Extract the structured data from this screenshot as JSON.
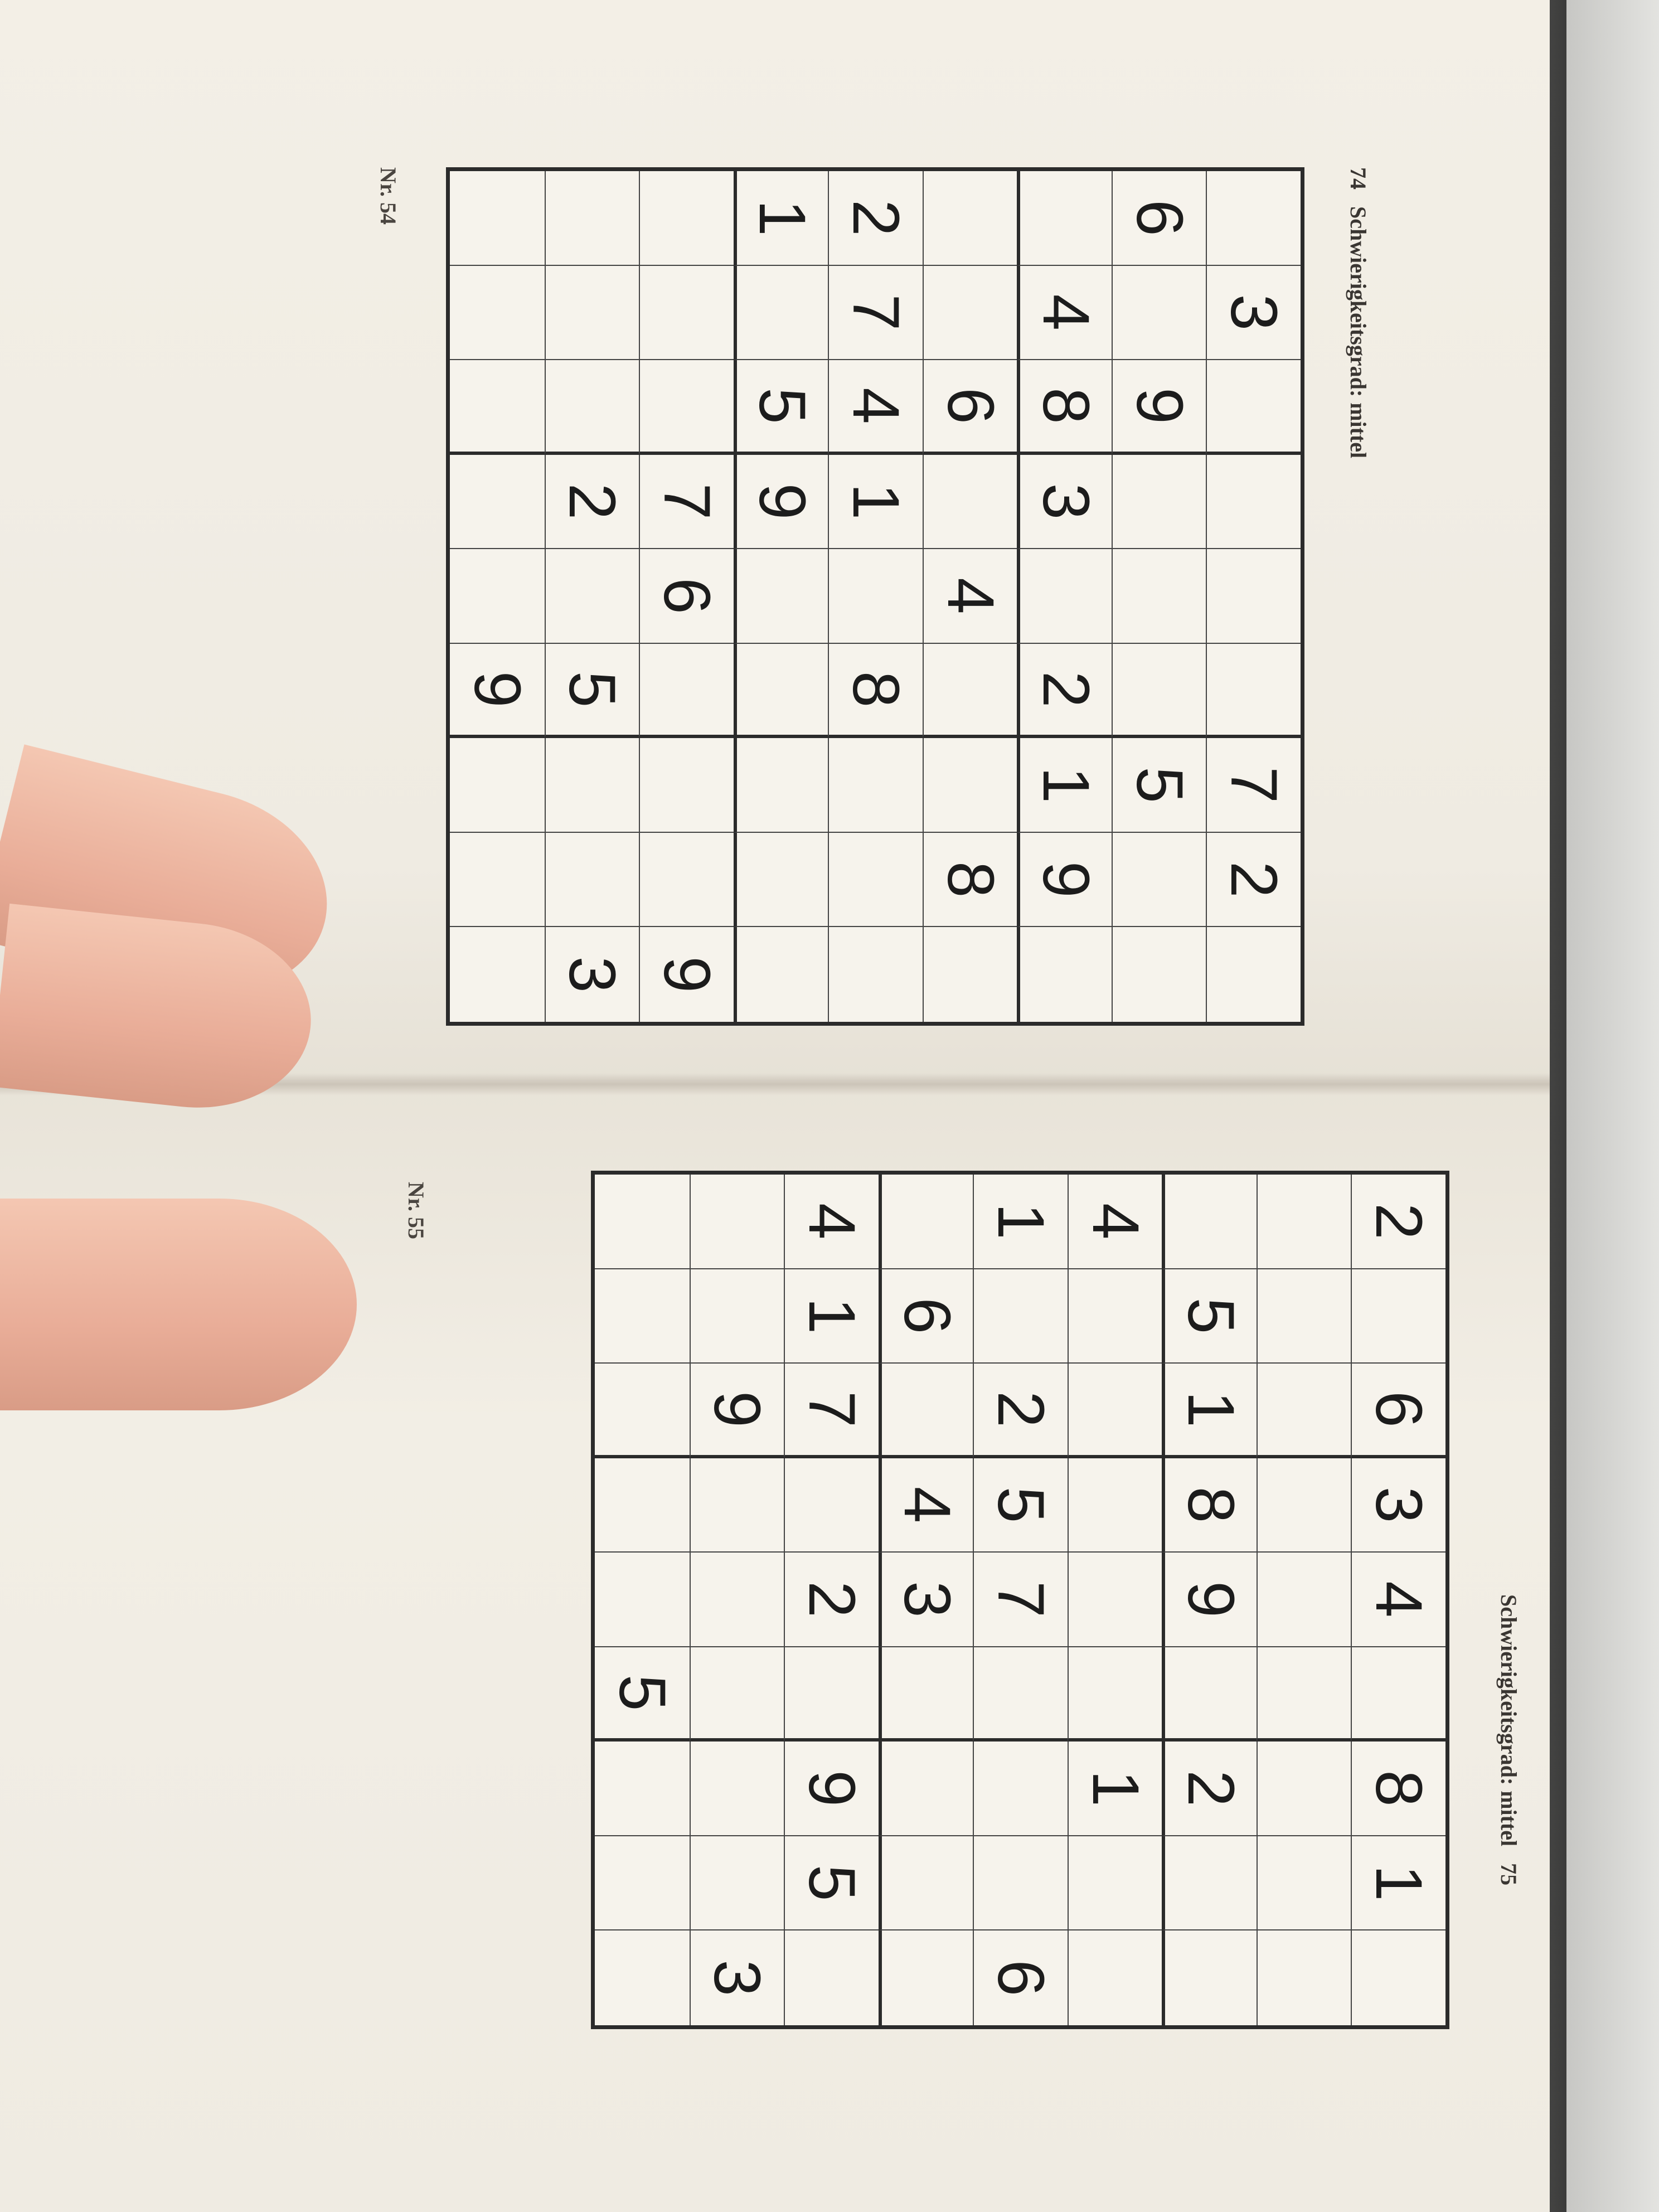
{
  "page_right": {
    "header": "Schwierigkeitsgrad: mittel",
    "page_number": "75",
    "puzzle_label": "Nr. 55",
    "grid": [
      [
        "2",
        "",
        "6",
        "3",
        "4",
        "",
        "8",
        "1",
        ""
      ],
      [
        "",
        "",
        "",
        "",
        "",
        "",
        "",
        "",
        ""
      ],
      [
        "",
        "5",
        "1",
        "8",
        "9",
        "",
        "2",
        "",
        ""
      ],
      [
        "4",
        "",
        "",
        "",
        "",
        "",
        "1",
        "",
        ""
      ],
      [
        "1",
        "",
        "2",
        "5",
        "7",
        "",
        "",
        "",
        "6"
      ],
      [
        "",
        "6",
        "",
        "4",
        "3",
        "",
        "",
        "",
        ""
      ],
      [
        "4",
        "1",
        "7",
        "",
        "2",
        "",
        "9",
        "5",
        ""
      ],
      [
        "",
        "",
        "9",
        "",
        "",
        "",
        "",
        "",
        "3"
      ],
      [
        "",
        "",
        "",
        "",
        "",
        "5",
        "",
        "",
        ""
      ]
    ]
  },
  "page_left": {
    "header": "Schwierigkeitsgrad: mittel",
    "page_number": "74",
    "puzzle_label": "Nr. 54",
    "grid": [
      [
        "",
        "3",
        "",
        "",
        "",
        "",
        "7",
        "2",
        ""
      ],
      [
        "6",
        "",
        "9",
        "",
        "",
        "",
        "5",
        "",
        ""
      ],
      [
        "",
        "4",
        "8",
        "3",
        "",
        "2",
        "1",
        "9",
        ""
      ],
      [
        "",
        "",
        "6",
        "",
        "4",
        "",
        "",
        "8",
        ""
      ],
      [
        "2",
        "7",
        "4",
        "1",
        "",
        "8",
        "",
        "",
        ""
      ],
      [
        "1",
        "",
        "5",
        "9",
        "",
        "",
        "",
        "",
        ""
      ],
      [
        "",
        "",
        "",
        "7",
        "6",
        "",
        "",
        "",
        "9"
      ],
      [
        "",
        "",
        "",
        "2",
        "",
        "5",
        "",
        "",
        "3"
      ],
      [
        "",
        "",
        "",
        "",
        "",
        "9",
        "",
        "",
        ""
      ]
    ]
  }
}
